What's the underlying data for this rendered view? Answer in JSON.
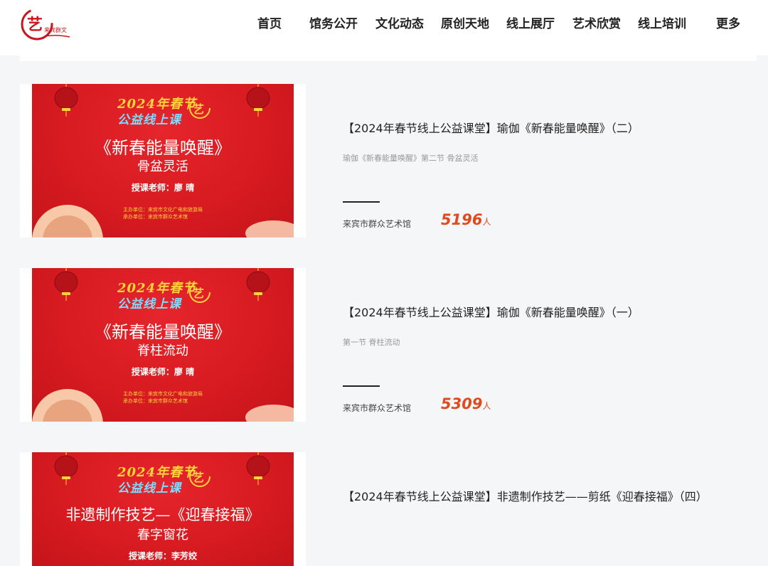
{
  "header": {
    "logo_name": "site-logo",
    "nav": [
      "首页",
      "馆务公开",
      "文化动态",
      "原创天地",
      "线上展厅",
      "艺术欣赏",
      "线上培训",
      "更多"
    ]
  },
  "courses": [
    {
      "thumb": {
        "year_line": "2024年春节",
        "sub_line": "公益线上课",
        "title": "《新春能量唤醒》",
        "subtitle": "骨盆灵活",
        "teacher": "授课老师：廖  晴",
        "org1": "主办单位：来宾市文化广电和旅游局",
        "org2": "承办单位：来宾市群众艺术馆"
      },
      "title": "【2024年春节线上公益课堂】瑜伽《新春能量唤醒》（二）",
      "desc": "瑜伽《新春能量唤醒》第二节 骨盆灵活",
      "org": "来宾市群众艺术馆",
      "count": "5196",
      "unit": "人"
    },
    {
      "thumb": {
        "year_line": "2024年春节",
        "sub_line": "公益线上课",
        "title": "《新春能量唤醒》",
        "subtitle": "脊柱流动",
        "teacher": "授课老师：廖  晴",
        "org1": "主办单位：来宾市文化广电和旅游局",
        "org2": "承办单位：来宾市群众艺术馆"
      },
      "title": "【2024年春节线上公益课堂】瑜伽《新春能量唤醒》（一）",
      "desc": "第一节 脊柱流动",
      "org": "来宾市群众艺术馆",
      "count": "5309",
      "unit": "人"
    },
    {
      "thumb": {
        "year_line": "2024年春节",
        "sub_line": "公益线上课",
        "title": "非遗制作技艺—《迎春接福》",
        "subtitle": "春字窗花",
        "teacher": "授课老师：李芳姣",
        "org1": "",
        "org2": ""
      },
      "title": "【2024年春节线上公益课堂】非遗制作技艺——剪纸《迎春接福》（四）",
      "desc": "",
      "org": "",
      "count": "",
      "unit": ""
    }
  ]
}
